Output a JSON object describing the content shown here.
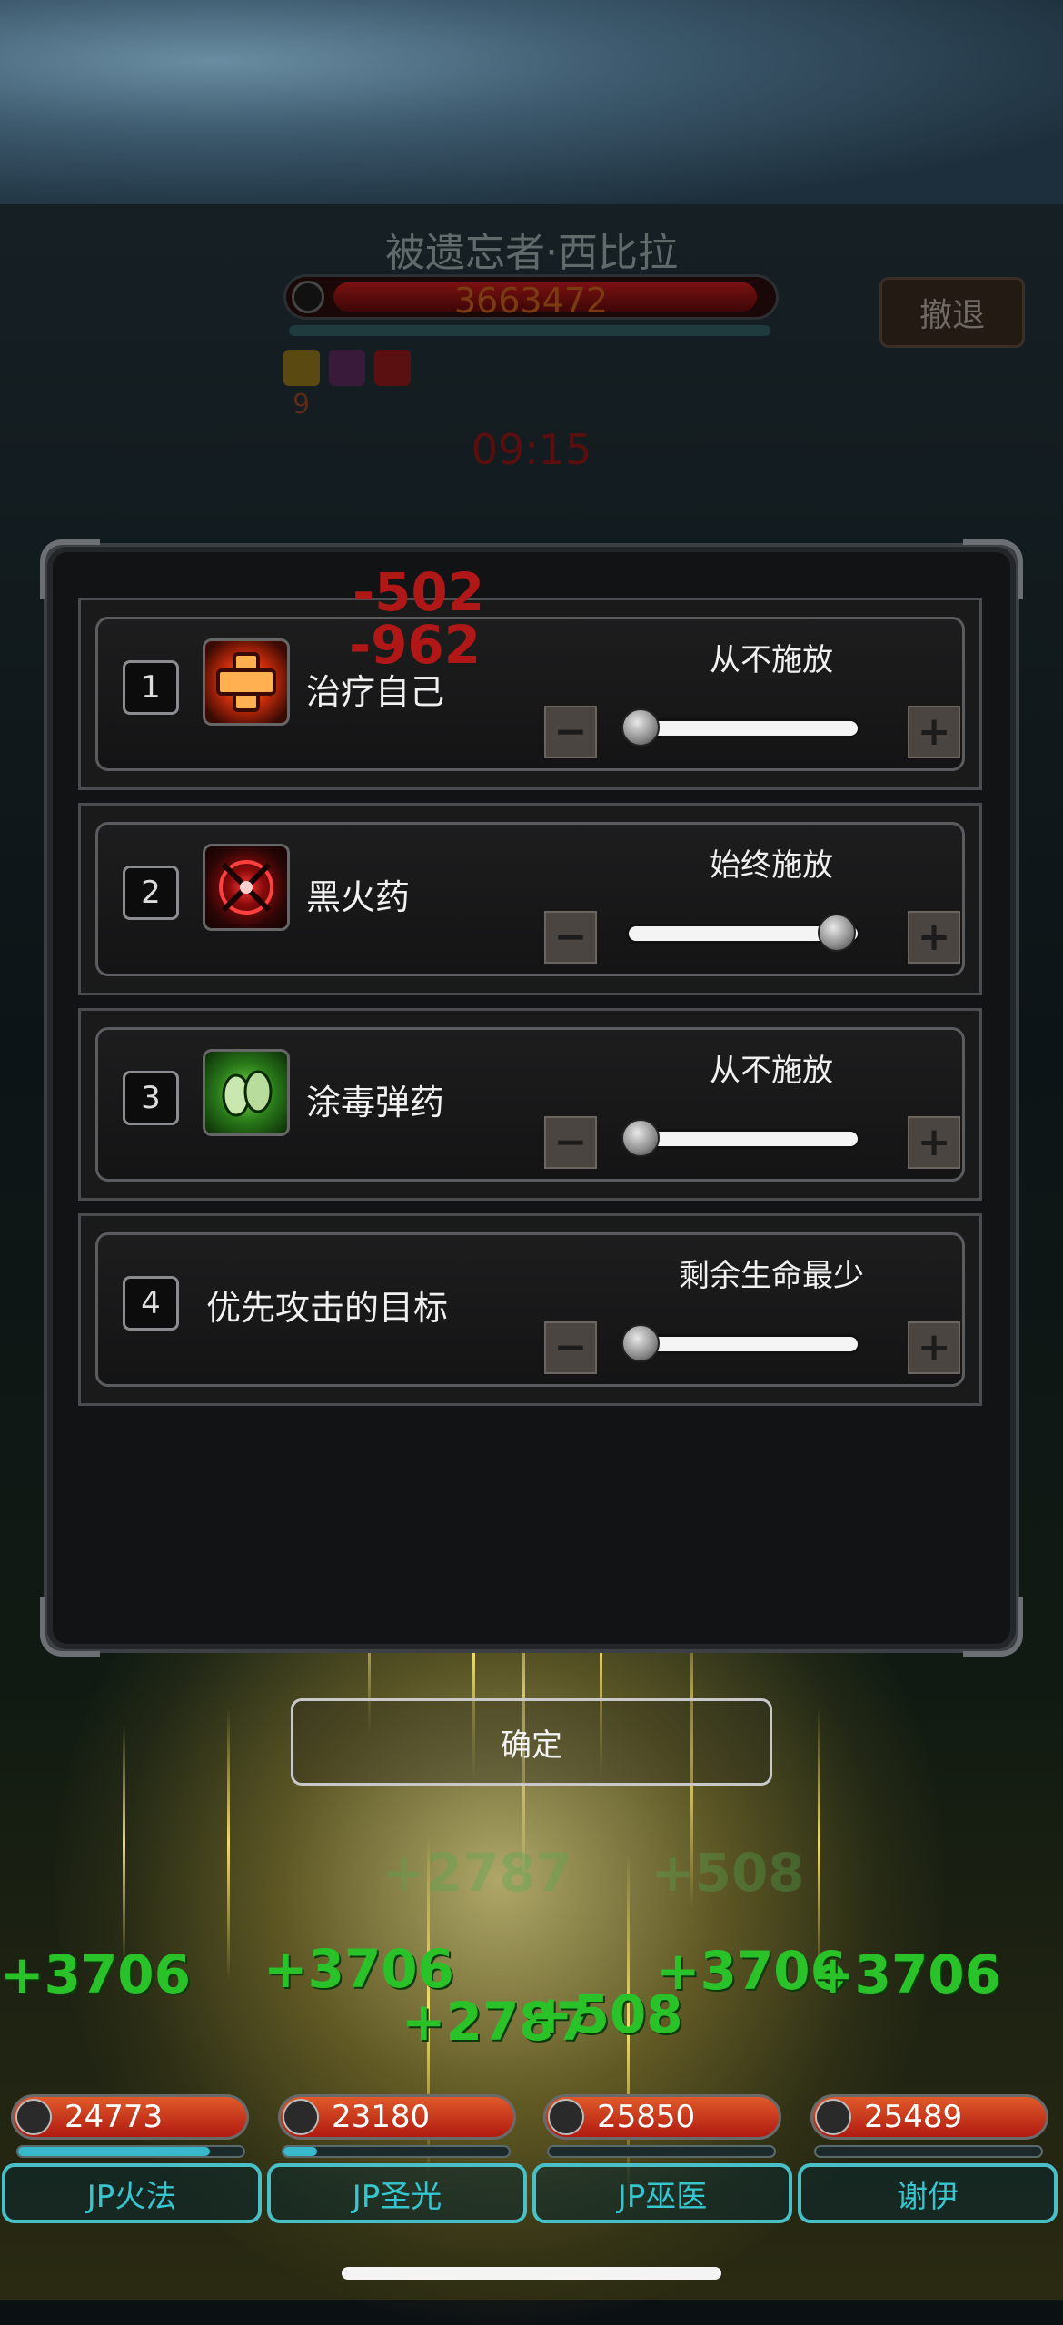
{
  "boss": {
    "name": "被遗忘者·西比拉",
    "hp": "3663472",
    "hp_fraction": 0.97,
    "buff_count": "9",
    "timer": "09:15"
  },
  "retreat_label": "撤退",
  "damage_popups": [
    "-502",
    "-962"
  ],
  "settings": [
    {
      "index": "1",
      "name": "治疗自己",
      "icon": "heal-cross-icon",
      "mode": "从不施放",
      "level": 0
    },
    {
      "index": "2",
      "name": "黑火药",
      "icon": "black-powder-icon",
      "mode": "始终施放",
      "level": 1
    },
    {
      "index": "3",
      "name": "涂毒弹药",
      "icon": "poison-ammo-icon",
      "mode": "从不施放",
      "level": 0
    },
    {
      "index": "4",
      "name": "优先攻击的目标",
      "icon": "",
      "mode": "剩余生命最少",
      "level": 0
    }
  ],
  "confirm_label": "确定",
  "heal_popups": [
    "+3706",
    "+3706",
    "+3706",
    "+3706",
    "+2787",
    "+508",
    "+2787",
    "+508"
  ],
  "party": [
    {
      "name": "JP火法",
      "hp": "24773",
      "mp_fraction": 0.85
    },
    {
      "name": "JP圣光",
      "hp": "23180",
      "mp_fraction": 0.15
    },
    {
      "name": "JP巫医",
      "hp": "25850",
      "mp_fraction": 0.0
    },
    {
      "name": "谢伊",
      "hp": "25489",
      "mp_fraction": 0.0
    }
  ],
  "colors": {
    "heal": "#29c229",
    "damage": "#b01818",
    "party_accent": "#36c6cf"
  }
}
